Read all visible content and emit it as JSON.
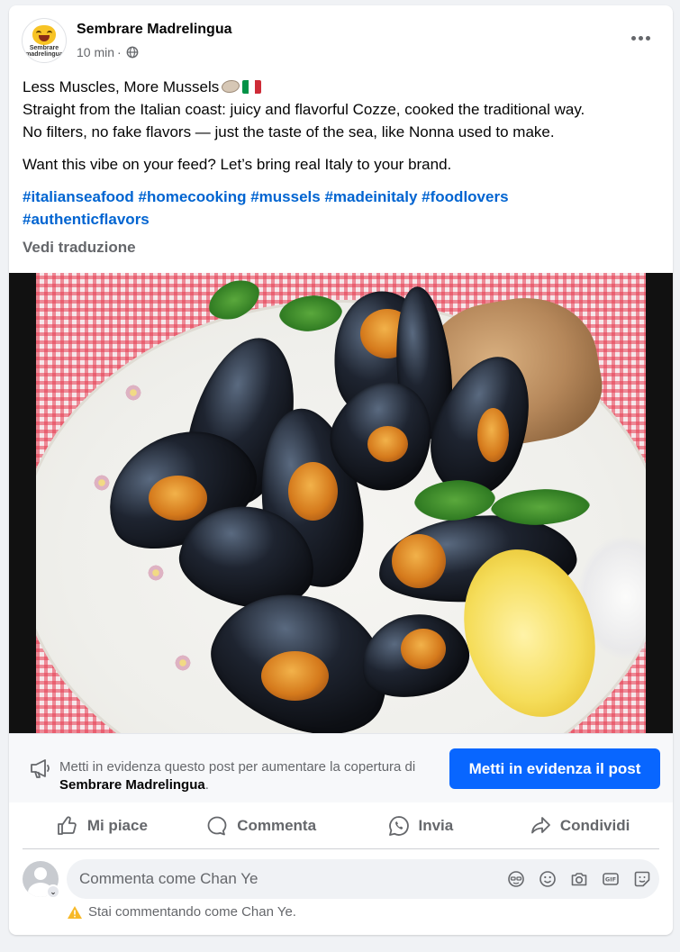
{
  "post": {
    "page_name": "Sembrare Madrelingua",
    "logo_text": "Sembrare madrelingua",
    "time": "10 min",
    "separator": "·",
    "privacy_icon": "globe-icon",
    "more_icon": "more-options-icon",
    "line1": "Less Muscles, More Mussels",
    "line1_emojis": [
      "oyster-emoji",
      "italy-flag-emoji"
    ],
    "line2": "Straight from the Italian coast: juicy and flavorful Cozze, cooked the traditional way.",
    "line3": "No filters, no fake flavors — just the taste of the sea, like Nonna used to make.",
    "line4": "Want this vibe on your feed? Let’s bring real Italy to your brand.",
    "hashtags": [
      "#italianseafood",
      "#homecooking",
      "#mussels",
      "#madeinitaly",
      "#foodlovers",
      "#authenticflavors"
    ],
    "see_translation": "Vedi traduzione",
    "image_subject": "mussels-dish-photo"
  },
  "boost": {
    "text_prefix": "Metti in evidenza questo post per aumentare la copertura di",
    "page_name": "Sembrare Madrelingua",
    "text_suffix": ".",
    "button_label": "Metti in evidenza il post"
  },
  "actions": [
    {
      "label": "Mi piace",
      "icon": "like-icon"
    },
    {
      "label": "Commenta",
      "icon": "comment-icon"
    },
    {
      "label": "Invia",
      "icon": "send-icon"
    },
    {
      "label": "Condividi",
      "icon": "share-icon"
    }
  ],
  "comment": {
    "placeholder": "Commenta come Chan Ye",
    "icons": [
      "avatar-sticker-icon",
      "emoji-icon",
      "camera-icon",
      "gif-icon",
      "sticker-icon"
    ],
    "warning": "Stai commentando come Chan Ye."
  },
  "colors": {
    "accent": "#0866ff",
    "link": "#0064d1",
    "secondary_text": "#65676b",
    "warning": "#f7b928"
  }
}
